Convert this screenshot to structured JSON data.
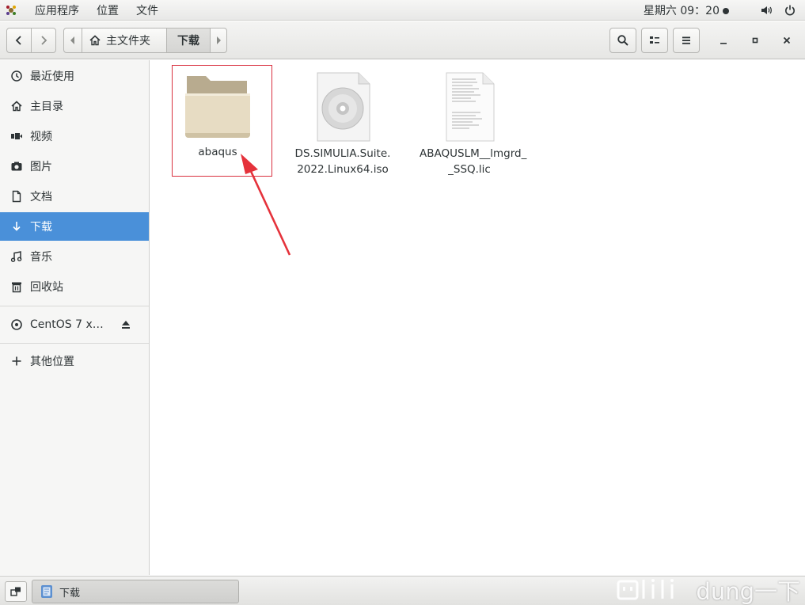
{
  "top_panel": {
    "menu": [
      "应用程序",
      "位置",
      "文件"
    ],
    "clock": "星期六 09：20"
  },
  "header": {
    "path": {
      "home_label": "主文件夹",
      "current_label": "下载"
    }
  },
  "sidebar": {
    "items": [
      {
        "label": "最近使用",
        "icon": "clock-icon"
      },
      {
        "label": "主目录",
        "icon": "home-icon"
      },
      {
        "label": "视频",
        "icon": "video-icon"
      },
      {
        "label": "图片",
        "icon": "camera-icon"
      },
      {
        "label": "文档",
        "icon": "document-icon"
      },
      {
        "label": "下载",
        "icon": "download-icon",
        "active": true
      },
      {
        "label": "音乐",
        "icon": "music-icon"
      },
      {
        "label": "回收站",
        "icon": "trash-icon"
      }
    ],
    "device": {
      "label": "CentOS 7 x…",
      "icon": "disc-icon"
    },
    "other": {
      "label": "其他位置",
      "icon": "plus-icon"
    }
  },
  "files": [
    {
      "name": "abaqus",
      "type": "folder",
      "highlighted": true
    },
    {
      "name_lines": [
        "DS.SIMULIA.Suite.",
        "2022.Linux64.iso"
      ],
      "type": "disc-image"
    },
    {
      "name_lines": [
        "ABAQUSLM__lmgrd_",
        "_SSQ.lic"
      ],
      "type": "text-file"
    }
  ],
  "taskbar": {
    "task_label": "下载"
  },
  "watermark": {
    "text": "dung一下"
  },
  "colors": {
    "accent": "#4a90d9",
    "highlight_border": "#d9303f",
    "arrow": "#e5323b",
    "folder": "#e7dcc3"
  }
}
